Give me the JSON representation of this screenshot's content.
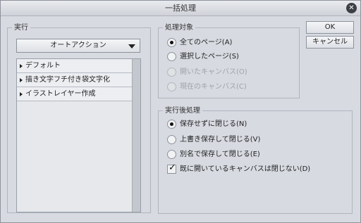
{
  "window": {
    "title": "一括処理"
  },
  "execute": {
    "legend": "実行",
    "dropdown_value": "オートアクション",
    "items": [
      {
        "label": "デフォルト"
      },
      {
        "label": "描き文字フチ付き袋文字化"
      },
      {
        "label": "イラストレイヤー作成"
      }
    ]
  },
  "target": {
    "legend": "処理対象",
    "options": [
      {
        "label": "全てのページ(A)",
        "checked": true,
        "enabled": true
      },
      {
        "label": "選択したページ(S)",
        "checked": false,
        "enabled": true
      },
      {
        "label": "開いたキャンバス(O)",
        "checked": false,
        "enabled": false
      },
      {
        "label": "現在のキャンバス(C)",
        "checked": false,
        "enabled": false
      }
    ]
  },
  "after": {
    "legend": "実行後処理",
    "options": [
      {
        "label": "保存せずに閉じる(N)",
        "checked": true
      },
      {
        "label": "上書き保存して閉じる(V)",
        "checked": false
      },
      {
        "label": "別名で保存して閉じる(E)",
        "checked": false
      }
    ],
    "checkbox": {
      "label": "既に開いているキャンバスは閉じない(D)",
      "checked": true
    }
  },
  "buttons": {
    "ok": "OK",
    "cancel": "キャンセル"
  }
}
